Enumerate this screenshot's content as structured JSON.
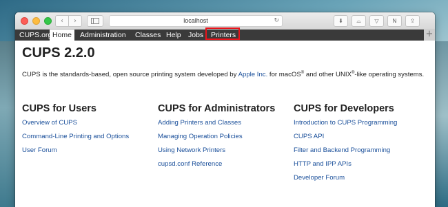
{
  "browser": {
    "url": "localhost",
    "nav_back": "‹",
    "nav_forward": "›",
    "reload": "↻",
    "new_tab": "+",
    "tools": [
      "⬇",
      "⌓",
      "▽",
      "N",
      "⇪"
    ]
  },
  "cups_nav": {
    "items": [
      "CUPS.org",
      "Home",
      "Administration",
      "Classes",
      "Help",
      "Jobs",
      "Printers"
    ],
    "active": "Home",
    "highlighted": "Printers"
  },
  "page": {
    "title": "CUPS 2.2.0",
    "intro_start": "CUPS is the standards-based, open source printing system developed by ",
    "intro_link": "Apple Inc.",
    "intro_mid1": " for macOS",
    "reg1": "®",
    "intro_mid2": " and other UNIX",
    "reg2": "®",
    "intro_end": "-like operating systems."
  },
  "columns": [
    {
      "heading": "CUPS for Users",
      "links": [
        "Overview of CUPS",
        "Command-Line Printing and Options",
        "User Forum"
      ]
    },
    {
      "heading": "CUPS for Administrators",
      "links": [
        "Adding Printers and Classes",
        "Managing Operation Policies",
        "Using Network Printers",
        "cupsd.conf Reference"
      ]
    },
    {
      "heading": "CUPS for Developers",
      "links": [
        "Introduction to CUPS Programming",
        "CUPS API",
        "Filter and Backend Programming",
        "HTTP and IPP APIs",
        "Developer Forum"
      ]
    }
  ],
  "colors": {
    "nav_bg": "#3a3a3a",
    "link": "#1a4f9a",
    "highlight_border": "#e8131a"
  }
}
